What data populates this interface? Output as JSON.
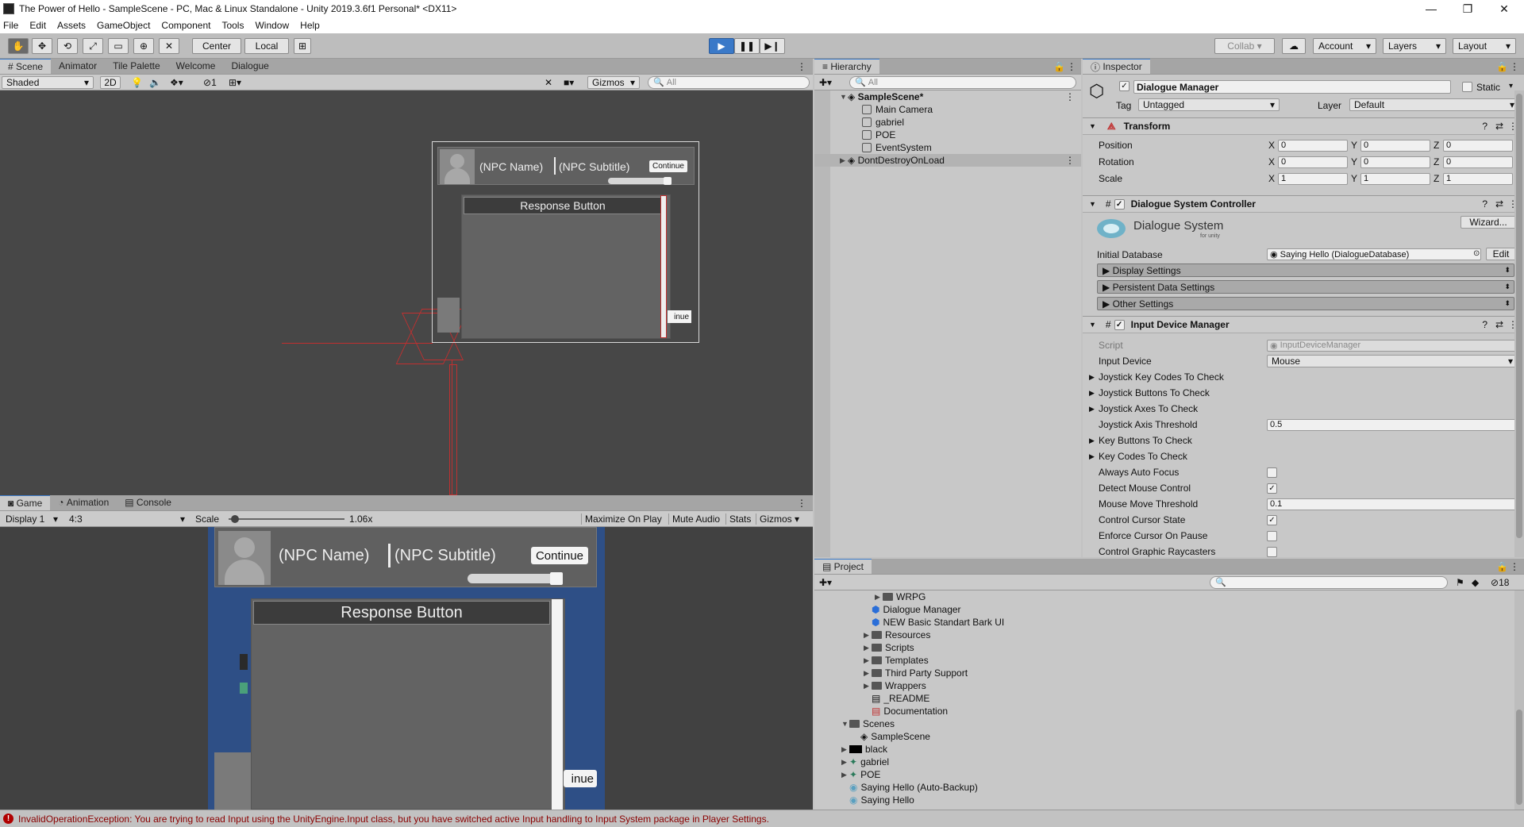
{
  "window": {
    "title": "The Power of Hello - SampleScene - PC, Mac & Linux Standalone - Unity 2019.3.6f1 Personal* <DX11>",
    "minimize": "—",
    "restore": "❐",
    "close": "✕"
  },
  "menu": [
    "File",
    "Edit",
    "Assets",
    "GameObject",
    "Component",
    "Tools",
    "Window",
    "Help"
  ],
  "toolbar": {
    "pivot": "Center",
    "space": "Local",
    "collab": "Collab",
    "account": "Account",
    "layers": "Layers",
    "layout": "Layout"
  },
  "scene": {
    "tabs": [
      "Scene",
      "Animator",
      "Tile Palette",
      "Welcome",
      "Dialogue"
    ],
    "shading": "Shaded",
    "mode2d": "2D",
    "gizmos": "Gizmos",
    "search_placeholder": "All",
    "fx_count": "1",
    "npc_name": "(NPC Name)",
    "npc_subtitle": "(NPC Subtitle)",
    "continue": "Continue",
    "response": "Response Button",
    "continue_partial": "inue"
  },
  "game": {
    "tabs": [
      "Game",
      "Animation",
      "Console"
    ],
    "display": "Display 1",
    "aspect": "4:3",
    "scale_label": "Scale",
    "scale_value": "1.06x",
    "scale_fraction": 0.02,
    "buttons": [
      "Maximize On Play",
      "Mute Audio",
      "Stats",
      "Gizmos"
    ],
    "npc_name": "(NPC Name)",
    "npc_subtitle": "(NPC Subtitle)",
    "continue": "Continue",
    "response": "Response Button",
    "continue_partial": "inue"
  },
  "hierarchy": {
    "tab": "Hierarchy",
    "search_placeholder": "All",
    "scene": "SampleScene*",
    "items": [
      "Main Camera",
      "gabriel",
      "POE",
      "EventSystem"
    ],
    "dontdestroy": "DontDestroyOnLoad"
  },
  "inspector": {
    "tab": "Inspector",
    "object_name": "Dialogue Manager",
    "static": "Static",
    "tag_label": "Tag",
    "tag_value": "Untagged",
    "layer_label": "Layer",
    "layer_value": "Default",
    "transform": {
      "title": "Transform",
      "rows": [
        {
          "label": "Position",
          "x": "0",
          "y": "0",
          "z": "0"
        },
        {
          "label": "Rotation",
          "x": "0",
          "y": "0",
          "z": "0"
        },
        {
          "label": "Scale",
          "x": "1",
          "y": "1",
          "z": "1"
        }
      ]
    },
    "dsc": {
      "title": "Dialogue System Controller",
      "logo": "Dialogue System",
      "logo_sub": "for unity",
      "wizard": "Wizard...",
      "db_label": "Initial Database",
      "db_value": "Saying Hello (DialogueDatabase)",
      "edit": "Edit",
      "foldouts": [
        "Display Settings",
        "Persistent Data Settings",
        "Other Settings"
      ]
    },
    "idm": {
      "title": "Input Device Manager",
      "script_label": "Script",
      "script_value": "InputDeviceManager",
      "device_label": "Input Device",
      "device_value": "Mouse",
      "foldouts": [
        "Joystick Key Codes To Check",
        "Joystick Buttons To Check",
        "Joystick Axes To Check"
      ],
      "threshold_label": "Joystick Axis Threshold",
      "threshold_value": "0.5",
      "foldouts2": [
        "Key Buttons To Check",
        "Key Codes To Check"
      ],
      "checks": [
        {
          "label": "Always Auto Focus",
          "checked": false
        },
        {
          "label": "Detect Mouse Control",
          "checked": true
        }
      ],
      "mouse_label": "Mouse Move Threshold",
      "mouse_value": "0.1",
      "checks2": [
        {
          "label": "Control Cursor State",
          "checked": true
        },
        {
          "label": "Enforce Cursor On Pause",
          "checked": false
        },
        {
          "label": "Control Graphic Raycasters",
          "checked": false
        }
      ]
    }
  },
  "project": {
    "tab": "Project",
    "hidden_count": "18",
    "items": [
      {
        "name": "WRPG",
        "indent": 4,
        "type": "folder",
        "arrow": "▶"
      },
      {
        "name": "Dialogue Manager",
        "indent": 3,
        "type": "prefab",
        "arrow": ""
      },
      {
        "name": "NEW Basic Standart Bark UI",
        "indent": 3,
        "type": "prefab",
        "arrow": ""
      },
      {
        "name": "Resources",
        "indent": 3,
        "type": "folder",
        "arrow": "▶"
      },
      {
        "name": "Scripts",
        "indent": 3,
        "type": "folder",
        "arrow": "▶"
      },
      {
        "name": "Templates",
        "indent": 3,
        "type": "folder",
        "arrow": "▶"
      },
      {
        "name": "Third Party Support",
        "indent": 3,
        "type": "folder",
        "arrow": "▶"
      },
      {
        "name": "Wrappers",
        "indent": 3,
        "type": "folder",
        "arrow": "▶"
      },
      {
        "name": "_README",
        "indent": 3,
        "type": "file",
        "arrow": ""
      },
      {
        "name": "Documentation",
        "indent": 3,
        "type": "pdf",
        "arrow": ""
      },
      {
        "name": "Scenes",
        "indent": 1,
        "type": "folder",
        "arrow": "▼"
      },
      {
        "name": "SampleScene",
        "indent": 2,
        "type": "scene",
        "arrow": ""
      },
      {
        "name": "black",
        "indent": 1,
        "type": "black",
        "arrow": "▶"
      },
      {
        "name": "gabriel",
        "indent": 1,
        "type": "sprite",
        "arrow": "▶"
      },
      {
        "name": "POE",
        "indent": 1,
        "type": "sprite",
        "arrow": "▶"
      },
      {
        "name": "Saying Hello (Auto-Backup)",
        "indent": 1,
        "type": "db",
        "arrow": ""
      },
      {
        "name": "Saying Hello",
        "indent": 1,
        "type": "db",
        "arrow": ""
      }
    ]
  },
  "status": {
    "message": "InvalidOperationException: You are trying to read Input using the UnityEngine.Input class, but you have switched active Input handling to Input System package in Player Settings."
  },
  "colors": {
    "accent": "#3a79c8",
    "scene_bg": "#474747",
    "game_bg": "#2e4f86",
    "error": "#b00000"
  }
}
